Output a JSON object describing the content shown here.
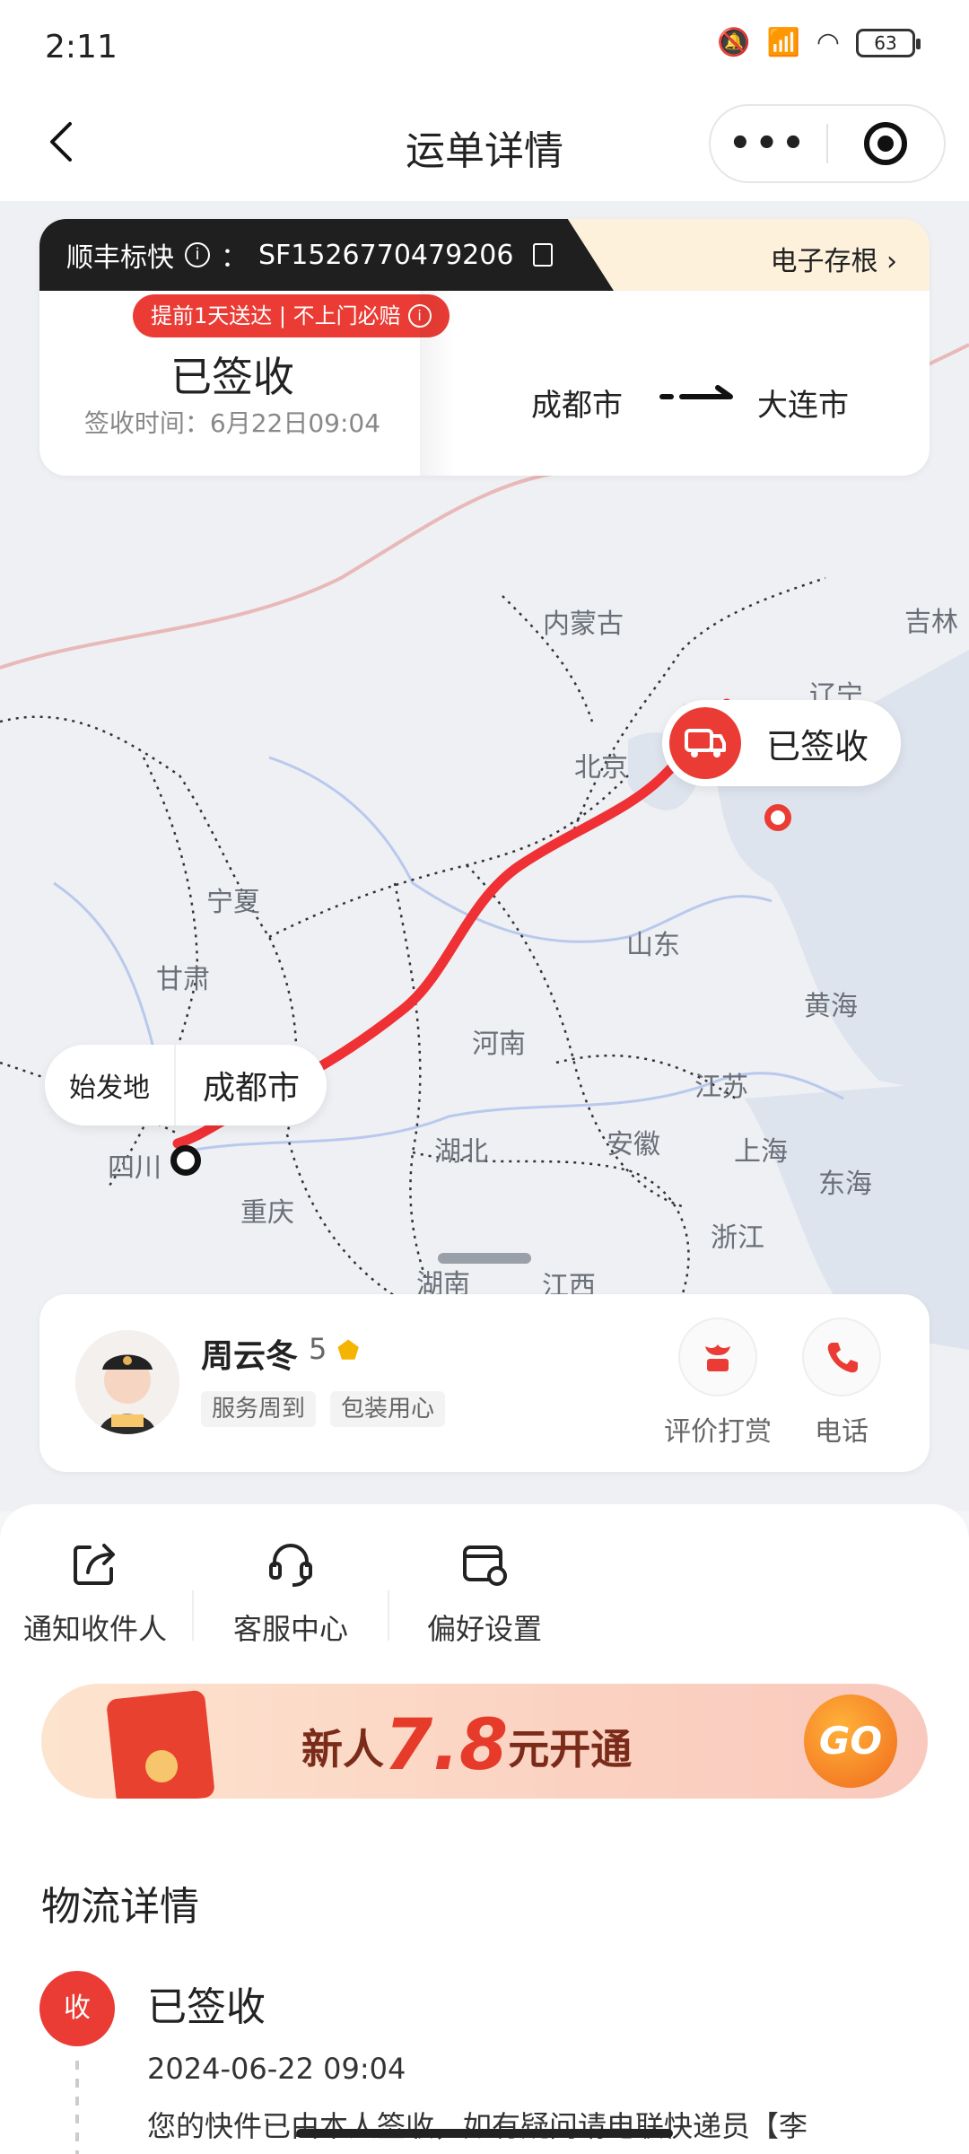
{
  "status_bar": {
    "time": "2:11",
    "battery": "63"
  },
  "nav": {
    "title": "运单详情",
    "more": "•••"
  },
  "waybill": {
    "product": "顺丰标快",
    "info_glyph": "i",
    "sep": "：",
    "number": "SF1526770479206",
    "stub_label": "电子存根",
    "badge": "提前1天送达 | 不上门必赔",
    "status": "已签收",
    "sign_time": "签收时间：6月22日09:04",
    "from_city": "成都市",
    "to_city": "大连市"
  },
  "map": {
    "provinces": [
      "内蒙古",
      "吉林",
      "辽宁",
      "北京",
      "宁夏",
      "甘肃",
      "山东",
      "黄海",
      "河南",
      "江苏",
      "上海",
      "湖北",
      "安徽",
      "东海",
      "四川",
      "重庆",
      "浙江",
      "湖南",
      "江西"
    ],
    "dest_marker_label": "已签收",
    "origin_tag": "始发地",
    "origin_city": "成都市"
  },
  "courier": {
    "name": "周云冬",
    "rating": "5",
    "tags": [
      "服务周到",
      "包装用心"
    ],
    "actions": [
      {
        "label": "评价打赏",
        "icon": "reward-icon"
      },
      {
        "label": "电话",
        "icon": "phone-icon"
      }
    ]
  },
  "quick_actions": [
    {
      "label": "通知收件人",
      "icon": "share-icon"
    },
    {
      "label": "客服中心",
      "icon": "headset-icon"
    },
    {
      "label": "偏好设置",
      "icon": "settings-card-icon"
    }
  ],
  "promo": {
    "prefix": "新人",
    "amount": "7.8",
    "suffix": "元开通",
    "go": "GO"
  },
  "logistics": {
    "section_title": "物流详情",
    "events": [
      {
        "badge": "收",
        "title": "已签收",
        "time": "2024-06-22 09:04",
        "desc": "您的快件已由本人签收，如有疑问请电联快递员【李"
      }
    ]
  },
  "colors": {
    "accent": "#ea3c35",
    "route": "#ef3034",
    "dark": "#1f1f1f"
  }
}
